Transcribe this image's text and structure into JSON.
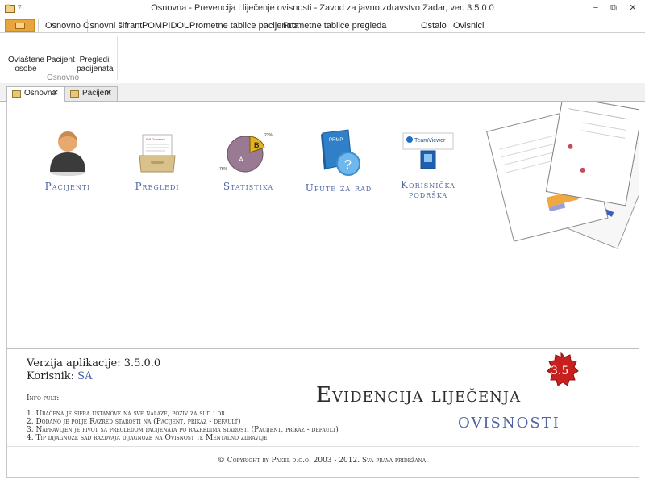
{
  "window": {
    "title": "Osnovna - Prevencija i liječenje ovisnosti - Zavod za javno zdravstvo Zadar, ver. 3.5.0.0",
    "quick_access": "▿",
    "minimize": "−",
    "restore": "⧉",
    "close": "✕"
  },
  "ribbon": {
    "tabs": [
      {
        "label": "Osnovno"
      },
      {
        "label": "Osnovni šifranti"
      },
      {
        "label": "POMPIDOU"
      },
      {
        "label": "Prometne tablice pacijenata"
      },
      {
        "label": "Prometne tablice pregleda"
      },
      {
        "label": "Ostalo"
      },
      {
        "label": "Ovisnici"
      }
    ],
    "buttons": [
      {
        "label_line1": "Ovlaštene",
        "label_line2": "osobe"
      },
      {
        "label_line1": "Pacijent",
        "label_line2": ""
      },
      {
        "label_line1": "Pregledi",
        "label_line2": "pacijenata"
      }
    ],
    "group_label": "Osnovno"
  },
  "doc_tabs": [
    {
      "label": "Osnovna",
      "close": "✕"
    },
    {
      "label": "Pacijent",
      "close": "✕"
    }
  ],
  "tiles": [
    {
      "label": "Pacijenti",
      "icon": "person-icon"
    },
    {
      "label": "Pregledi",
      "icon": "file-box-icon"
    },
    {
      "label": "Statistika",
      "icon": "pie-chart-icon"
    },
    {
      "label": "Upute za rad",
      "icon": "help-book-icon"
    },
    {
      "label_line1": "Korisnička",
      "label_line2": "podrška",
      "icon": "teamviewer-icon"
    }
  ],
  "stats_icon": {
    "slice_a": "A",
    "slice_b": "B",
    "pct1": "22%",
    "pct2": "78%"
  },
  "manual_icon": {
    "text": "PRMP"
  },
  "teamviewer_icon": {
    "text": "TeamViewer"
  },
  "pregledi_icon": {
    "text": "Pdf Oviseesti"
  },
  "info": {
    "version_label": "Verzija aplikacije: 3.5.0.0",
    "user_label": "Korisnik:",
    "user_value": "SA",
    "header": "Info pult:",
    "items": [
      "1. Ubačena je šifra ustanove na sve nalaze, poziv za sud i dr.",
      "2. Dodano je polje Razred starosti na (Pacijent, prikaz - default)",
      "3. Napravljen je pivot sa pregledom pacijenata po razredima starosti (Pacijent, prikaz - default)",
      "4. Tip dijagnoze sad razdvaja dijagnoze na Ovisnost te Mentalno zdravlje"
    ]
  },
  "brand": {
    "line1": "Evidencija liječenja",
    "line2": "ovisnosti",
    "badge": "3.5",
    "badge_color": "#c81f1f"
  },
  "copyright": "© Copyright by Pakel d.o.o. 2003 - 2012. Sva prava pridržana."
}
